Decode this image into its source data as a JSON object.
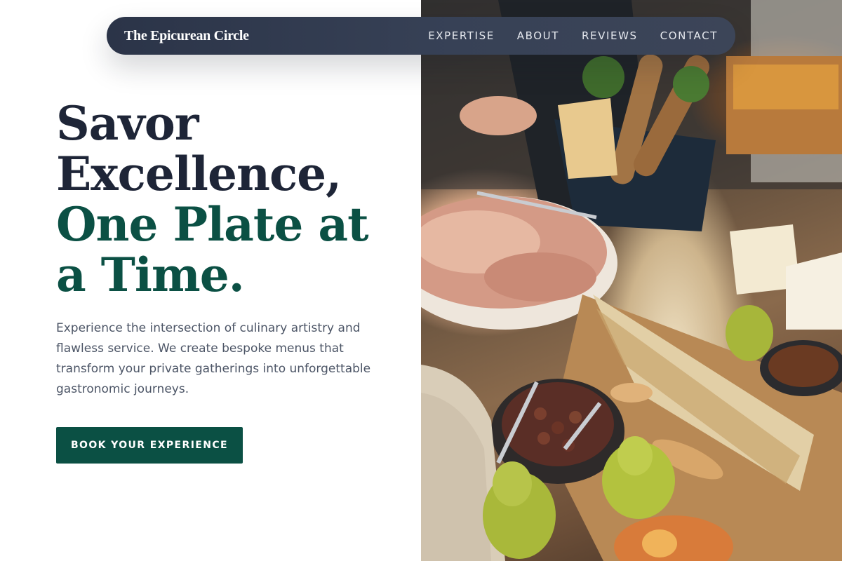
{
  "brand": {
    "name": "The Epicurean Circle"
  },
  "nav": {
    "links": [
      {
        "label": "EXPERTISE"
      },
      {
        "label": "ABOUT"
      },
      {
        "label": "REVIEWS"
      },
      {
        "label": "CONTACT"
      }
    ]
  },
  "hero": {
    "headline_line1": "Savor",
    "headline_line2": "Excellence,",
    "headline_line3": "One Plate at",
    "headline_line4": "a Time.",
    "description": "Experience the intersection of culinary artistry and flawless service. We create bespoke menus that transform your private gatherings into unforgettable gastronomic journeys.",
    "cta_label": "BOOK YOUR EXPERIENCE"
  },
  "image": {
    "subject": "catering-grazing-table-photo"
  },
  "colors": {
    "navbar": "#2b3448",
    "headline_dark": "#1e2537",
    "headline_accent": "#0b5044",
    "cta_background": "#0b5044",
    "body_text": "#4c5566"
  }
}
